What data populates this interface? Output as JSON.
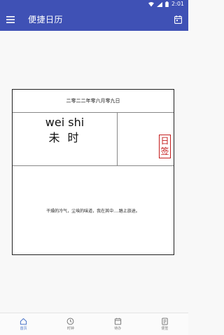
{
  "status_bar": {
    "time": "2:01"
  },
  "app_bar": {
    "title": "便捷日历",
    "menu_icon": "hamburger-menu-icon",
    "calendar_icon": "calendar-icon"
  },
  "almanac": {
    "date_text": "二零二二年零六月零九日",
    "hour_pinyin": "wei shi",
    "hour_hanzi": "未 时",
    "stamp_chars": [
      "日",
      "签"
    ],
    "quote": "干燥的冷气，尘埃的味道，我在其中....踏上旅途。"
  },
  "bottom_nav": {
    "items": [
      {
        "label": "首页",
        "icon": "home-icon",
        "active": true
      },
      {
        "label": "时钟",
        "icon": "clock-icon",
        "active": false
      },
      {
        "label": "待办",
        "icon": "todo-icon",
        "active": false
      },
      {
        "label": "便签",
        "icon": "note-icon",
        "active": false
      }
    ]
  },
  "colors": {
    "primary": "#3f51b5",
    "active_tab": "#4a74c9",
    "stamp_red": "#c41c1c"
  }
}
